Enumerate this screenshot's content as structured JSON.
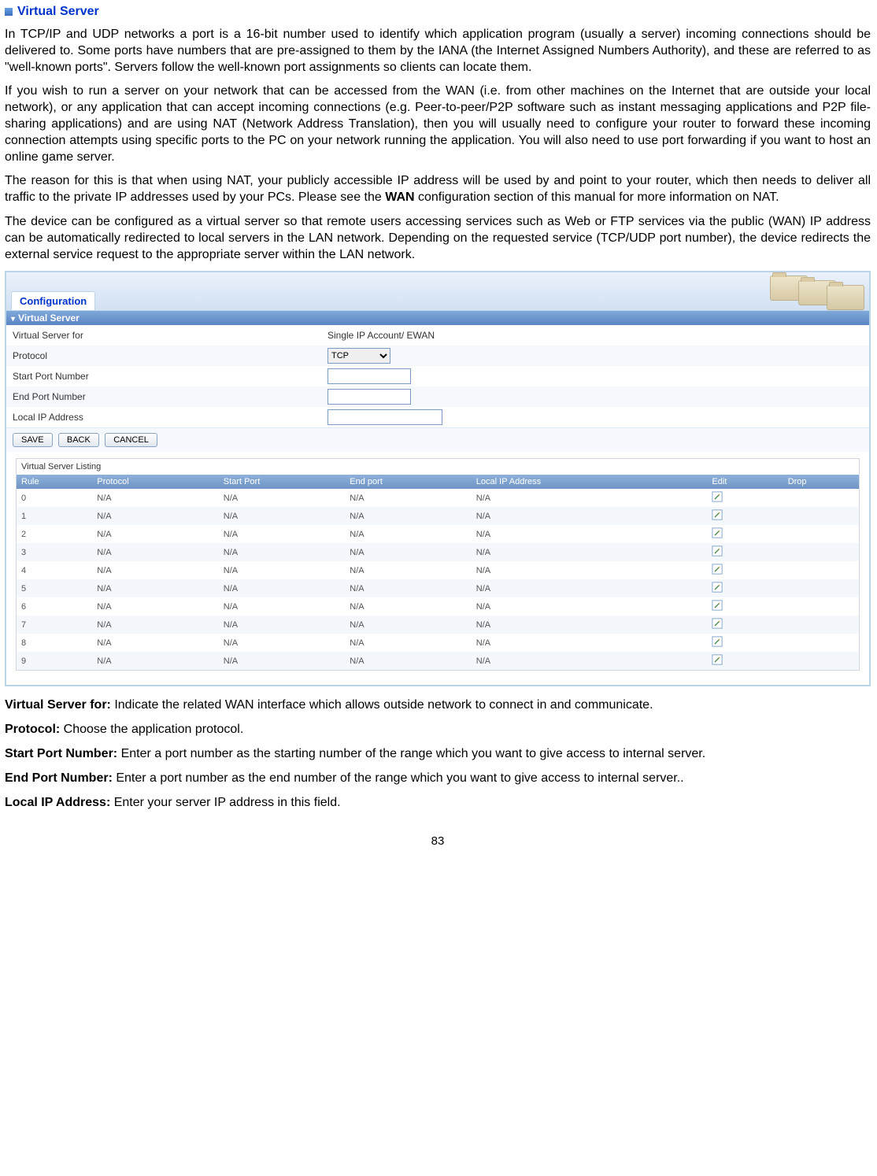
{
  "page_number": "83",
  "section": {
    "title": "Virtual Server"
  },
  "paragraphs": {
    "p1": "In TCP/IP and UDP networks a port is a 16-bit number used to identify which application program (usually a server) incoming connections should be delivered to. Some ports have numbers that are pre-assigned to them by the IANA (the Internet Assigned Numbers Authority), and these are referred to as \"well-known ports\". Servers follow the well-known port assignments so clients can locate them.",
    "p2": "If you wish to run a server on your network that can be accessed from the WAN (i.e. from other machines on the Internet that are outside your local network), or any application that can accept incoming connections (e.g. Peer-to-peer/P2P software such as instant messaging applications and P2P file-sharing applications) and are using NAT (Network Address Translation), then you will usually need to configure your router to forward these incoming connection attempts using specific ports to the PC on your network running the application. You will also need to use port forwarding if you want to host an online game server.",
    "p3a": "The reason for this is that when using NAT, your publicly accessible IP address will be used by and point to your router, which then needs to deliver all traffic to the private IP addresses used by your PCs. Please see the ",
    "p3b": "WAN",
    "p3c": " configuration section of this manual for more information on NAT.",
    "p4": "The device can be configured as a virtual server so that remote users accessing services such as Web or FTP services via the public (WAN) IP address can be automatically redirected to local servers in the LAN network. Depending on the requested service (TCP/UDP port number), the device redirects the external service request to the appropriate server within the LAN network."
  },
  "config_panel": {
    "tab": "Configuration",
    "section_bar": "Virtual Server",
    "fields": {
      "virtual_server_for": {
        "label": "Virtual Server for",
        "value": "Single IP Account/ EWAN"
      },
      "protocol": {
        "label": "Protocol",
        "value": "TCP"
      },
      "start_port": {
        "label": "Start Port Number",
        "value": ""
      },
      "end_port": {
        "label": "End Port Number",
        "value": ""
      },
      "local_ip": {
        "label": "Local IP Address",
        "value": ""
      }
    },
    "buttons": {
      "save": "SAVE",
      "back": "BACK",
      "cancel": "CANCEL"
    },
    "listing": {
      "title": "Virtual Server Listing",
      "headers": {
        "rule": "Rule",
        "protocol": "Protocol",
        "start": "Start Port",
        "end": "End port",
        "local": "Local IP Address",
        "edit": "Edit",
        "drop": "Drop"
      },
      "rows": [
        {
          "rule": "0",
          "protocol": "N/A",
          "start": "N/A",
          "end": "N/A",
          "local": "N/A"
        },
        {
          "rule": "1",
          "protocol": "N/A",
          "start": "N/A",
          "end": "N/A",
          "local": "N/A"
        },
        {
          "rule": "2",
          "protocol": "N/A",
          "start": "N/A",
          "end": "N/A",
          "local": "N/A"
        },
        {
          "rule": "3",
          "protocol": "N/A",
          "start": "N/A",
          "end": "N/A",
          "local": "N/A"
        },
        {
          "rule": "4",
          "protocol": "N/A",
          "start": "N/A",
          "end": "N/A",
          "local": "N/A"
        },
        {
          "rule": "5",
          "protocol": "N/A",
          "start": "N/A",
          "end": "N/A",
          "local": "N/A"
        },
        {
          "rule": "6",
          "protocol": "N/A",
          "start": "N/A",
          "end": "N/A",
          "local": "N/A"
        },
        {
          "rule": "7",
          "protocol": "N/A",
          "start": "N/A",
          "end": "N/A",
          "local": "N/A"
        },
        {
          "rule": "8",
          "protocol": "N/A",
          "start": "N/A",
          "end": "N/A",
          "local": "N/A"
        },
        {
          "rule": "9",
          "protocol": "N/A",
          "start": "N/A",
          "end": "N/A",
          "local": "N/A"
        }
      ]
    }
  },
  "definitions": {
    "d1_label": "Virtual Server for:",
    "d1_text": " Indicate the related WAN interface which allows outside network to connect in and communicate.",
    "d2_label": "Protocol:",
    "d2_text": " Choose the application protocol.",
    "d3_label": "Start Port Number:",
    "d3_text": " Enter a port number as the starting number of the range which you want to give  access to internal server.",
    "d4_label": "End Port Number:",
    "d4_text": " Enter a port number as the end number of the range which you want to give access to internal server..",
    "d5_label": "Local IP Address:",
    "d5_text": " Enter your server IP address in this field."
  }
}
